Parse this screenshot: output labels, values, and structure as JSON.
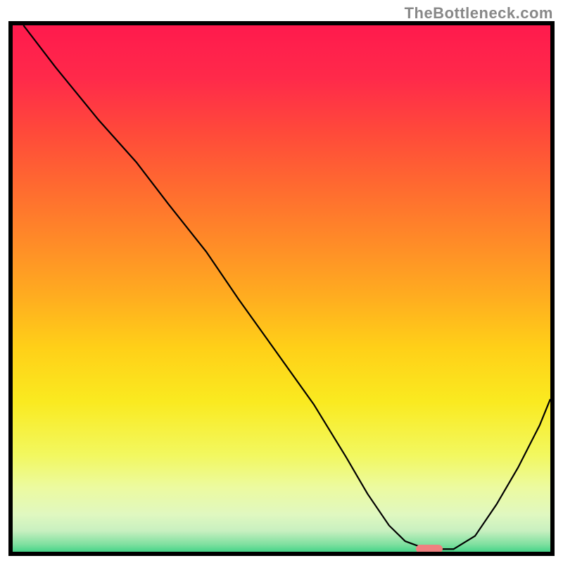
{
  "attribution": "TheBottleneck.com",
  "chart_data": {
    "type": "line",
    "title": "",
    "xlabel": "",
    "ylabel": "",
    "xlim": [
      0,
      100
    ],
    "ylim": [
      0,
      100
    ],
    "series": [
      {
        "name": "curve",
        "x": [
          2,
          8,
          16,
          23,
          29,
          36,
          42,
          49,
          56,
          62,
          66,
          70,
          73,
          77,
          82,
          86,
          90,
          94,
          98,
          100
        ],
        "y": [
          100,
          92,
          82,
          74,
          66,
          57,
          48,
          38,
          28,
          18,
          11,
          5,
          2,
          0.5,
          0.5,
          3,
          9,
          16,
          24,
          29
        ]
      }
    ],
    "marker": {
      "x": 77.5,
      "y": 0.5,
      "width_pct": 5,
      "height_pct": 1.6
    },
    "gradient_stops": [
      {
        "offset": 0.0,
        "color": "#ff1a4d"
      },
      {
        "offset": 0.1,
        "color": "#ff2a4a"
      },
      {
        "offset": 0.2,
        "color": "#ff4a3a"
      },
      {
        "offset": 0.3,
        "color": "#ff6a30"
      },
      {
        "offset": 0.4,
        "color": "#ff8a28"
      },
      {
        "offset": 0.5,
        "color": "#ffab20"
      },
      {
        "offset": 0.6,
        "color": "#ffd018"
      },
      {
        "offset": 0.7,
        "color": "#faea20"
      },
      {
        "offset": 0.8,
        "color": "#f2f860"
      },
      {
        "offset": 0.86,
        "color": "#ecfaa0"
      },
      {
        "offset": 0.91,
        "color": "#e0f8c0"
      },
      {
        "offset": 0.94,
        "color": "#c8f0c0"
      },
      {
        "offset": 0.965,
        "color": "#80e0a0"
      },
      {
        "offset": 0.985,
        "color": "#30d080"
      },
      {
        "offset": 1.0,
        "color": "#18c868"
      }
    ]
  }
}
